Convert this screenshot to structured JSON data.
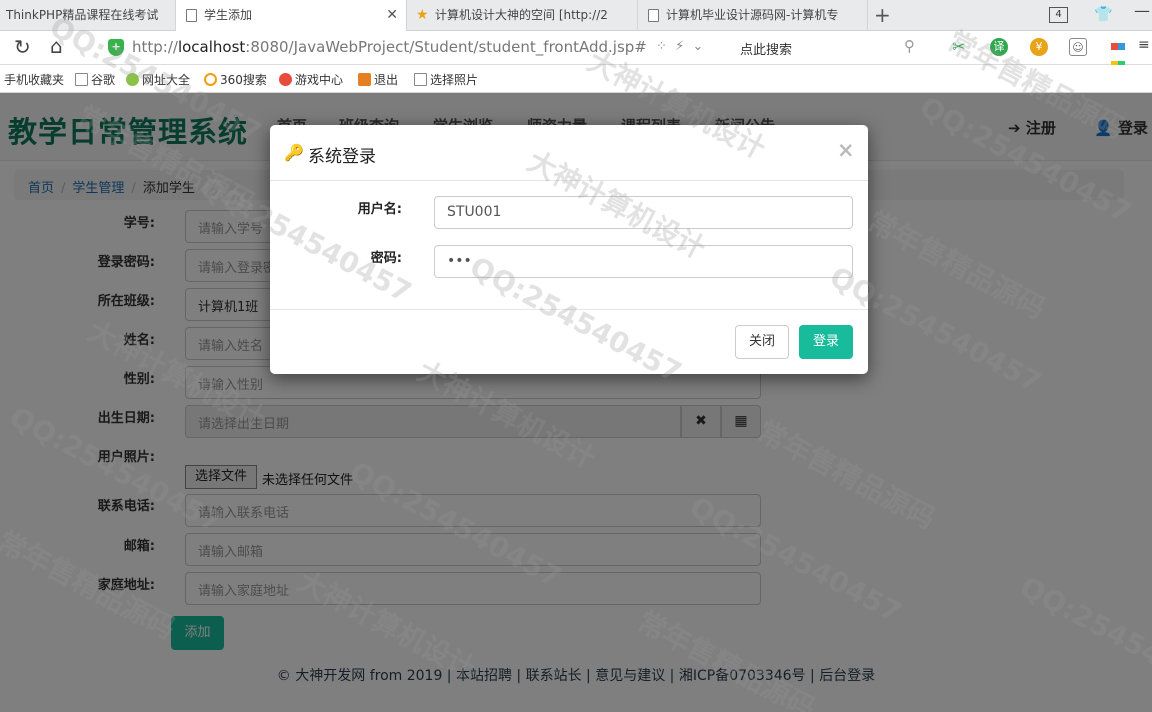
{
  "browser": {
    "tabs": [
      {
        "title": "ThinkPHP精品课程在线考试"
      },
      {
        "title": "学生添加"
      },
      {
        "title": "计算机设计大神的空间 [http://2"
      },
      {
        "title": "计算机毕业设计源码网-计算机专"
      }
    ],
    "tab_count": "4",
    "url_prefix": "http://",
    "url_host": "localhost",
    "url_rest": ":8080/JavaWebProject/Student/student_frontAdd.jsp#",
    "search_prompt": "点此搜索",
    "ext_translate": "译",
    "ext_yen": "¥",
    "bookmarks": [
      "手机收藏夹",
      "谷歌",
      "网址大全",
      "360搜索",
      "游戏中心",
      "退出",
      "选择照片"
    ]
  },
  "site": {
    "brand": "教学日常管理系统",
    "menu": [
      "首页",
      "班级查询",
      "学生浏览",
      "师资力量",
      "课程列表",
      "新闻公告"
    ],
    "register": "注册",
    "login": "登录",
    "breadcrumb": [
      "首页",
      "学生管理",
      "添加学生"
    ]
  },
  "form": {
    "student_no_label": "学号:",
    "student_no_placeholder": "请输入学号",
    "password_label": "登录密码:",
    "password_placeholder": "请输入登录密码",
    "class_label": "所在班级:",
    "class_value": "计算机1班",
    "name_label": "姓名:",
    "name_placeholder": "请输入姓名",
    "gender_label": "性别:",
    "gender_placeholder": "请输入性别",
    "birthday_label": "出生日期:",
    "birthday_placeholder": "请选择出生日期",
    "photo_label": "用户照片:",
    "file_button": "选择文件",
    "file_status": "未选择任何文件",
    "phone_label": "联系电话:",
    "phone_placeholder": "请输入联系电话",
    "email_label": "邮箱:",
    "email_placeholder": "请输入邮箱",
    "address_label": "家庭地址:",
    "address_placeholder": "请输入家庭地址",
    "add_button": "添加"
  },
  "footer": {
    "copyright": "© 大神开发网 from 2019",
    "links": [
      "本站招聘",
      "联系站长",
      "意见与建议",
      "湘ICP备0703346号",
      "后台登录"
    ]
  },
  "modal": {
    "title": "系统登录",
    "close_x": "×",
    "username_label": "用户名:",
    "username_value": "STU001",
    "password_label": "密码:",
    "password_value": "•••",
    "close_button": "关闭",
    "login_button": "登录"
  },
  "watermark": {
    "qq": "QQ:254540457",
    "designer": "大神计算机设计",
    "slogan": "常年售精品源码"
  },
  "colors": {
    "brand": "#0e7a5e",
    "primary_button": "#18bc9c",
    "link": "#1f6fb2"
  }
}
